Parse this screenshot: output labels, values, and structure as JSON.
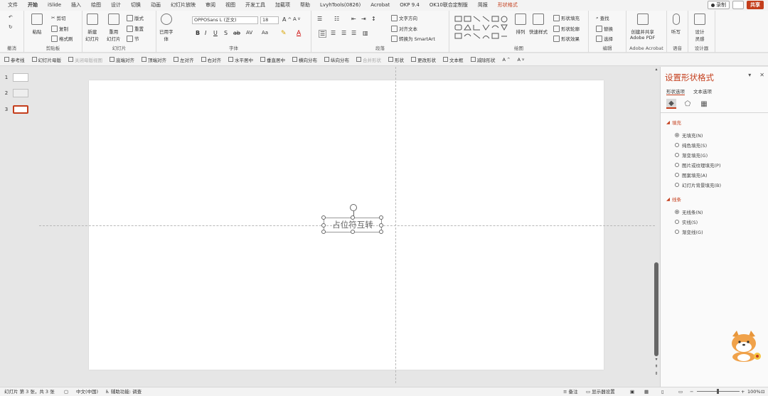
{
  "menu": {
    "items": [
      "文件",
      "开始",
      "iSlide",
      "插入",
      "绘图",
      "设计",
      "切换",
      "动画",
      "幻灯片放映",
      "审阅",
      "视图",
      "开发工具",
      "加载项",
      "帮助",
      "LvyhTools(0826)",
      "Acrobat",
      "OKP 9.4",
      "OK10联合定制版",
      "简报",
      "形状格式"
    ],
    "record": "录制",
    "share": "共享"
  },
  "ribbon": {
    "undo_group": "撤消",
    "clipboard": {
      "label": "剪贴板",
      "paste": "粘贴",
      "cut": "剪切",
      "copy": "复制",
      "format_painter": "格式刷"
    },
    "slides": {
      "label": "幻灯片",
      "new_slide": "新建\n幻灯片",
      "reuse": "重用\n幻灯片",
      "layout": "版式",
      "reset": "重置",
      "section": "节"
    },
    "font_group": {
      "label": "字体",
      "used_font": "已用字\n体",
      "font_name": "OPPOSans L (正文)",
      "font_size": "18"
    },
    "paragraph": {
      "label": "段落",
      "text_direction": "文字方向",
      "align_text": "对齐文本",
      "smartart": "转换为 SmartArt"
    },
    "drawing": {
      "label": "绘图",
      "arrange": "排列",
      "quick_styles": "快速样式",
      "fill": "形状填充",
      "outline": "形状轮廓",
      "effects": "形状效果"
    },
    "editing": {
      "label": "编辑",
      "find": "查找",
      "replace": "替换",
      "select": "选择"
    },
    "acrobat": {
      "label": "Adobe Acrobat",
      "create": "创建并共享\nAdobe PDF"
    },
    "voice": {
      "label": "语音",
      "dictate": "听写"
    },
    "designer": {
      "label": "设计器",
      "ideas": "设计\n灵感"
    }
  },
  "toolbar2": [
    {
      "label": "参考线",
      "disabled": false
    },
    {
      "label": "幻灯片母版",
      "disabled": false
    },
    {
      "label": "关闭母版视图",
      "disabled": true
    },
    {
      "label": "底端对齐",
      "disabled": false
    },
    {
      "label": "顶端对齐",
      "disabled": false
    },
    {
      "label": "左对齐",
      "disabled": false
    },
    {
      "label": "右对齐",
      "disabled": false
    },
    {
      "label": "水平居中",
      "disabled": false
    },
    {
      "label": "垂直居中",
      "disabled": false
    },
    {
      "label": "横向分布",
      "disabled": false
    },
    {
      "label": "纵向分布",
      "disabled": false
    },
    {
      "label": "合并形状",
      "disabled": true
    },
    {
      "label": "形状",
      "disabled": false
    },
    {
      "label": "更改形状",
      "disabled": false
    },
    {
      "label": "文本框",
      "disabled": false
    },
    {
      "label": "减除形状",
      "disabled": false
    }
  ],
  "thumbnails": [
    "1",
    "2",
    "3"
  ],
  "slide": {
    "placeholder_text": "占位符互转"
  },
  "pane": {
    "title": "设置形状格式",
    "tabs": [
      "形状选项",
      "文本选项"
    ],
    "fill_section": "填充",
    "fill_options": [
      "无填充(N)",
      "纯色填充(S)",
      "渐变填充(G)",
      "图片或纹理填充(P)",
      "图案填充(A)",
      "幻灯片背景填充(B)"
    ],
    "line_section": "线条",
    "line_options": [
      "无线条(N)",
      "实线(S)",
      "渐变线(G)"
    ]
  },
  "status": {
    "slide_info": "幻灯片 第 3 张，共 3 张",
    "language": "中文(中国)",
    "accessibility": "辅助功能: 调查",
    "notes": "备注",
    "display_settings": "显示器设置",
    "zoom": "100%"
  },
  "colors": {
    "accent": "#c43e1c"
  }
}
